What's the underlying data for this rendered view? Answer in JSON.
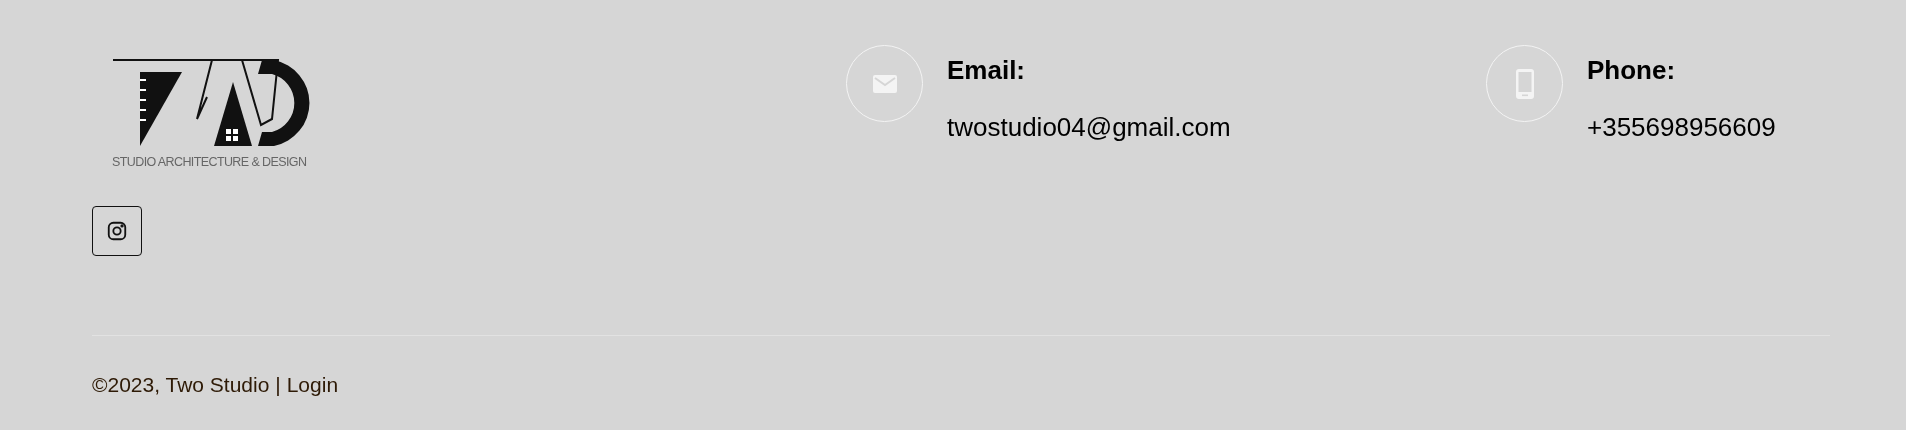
{
  "logo": {
    "tagline": "STUDIO ARCHITECTURE & DESIGN"
  },
  "social": [
    {
      "kind": "instagram"
    }
  ],
  "contacts": [
    {
      "kind": "email",
      "label": "Email:",
      "value": "twostudio04@gmail.com"
    },
    {
      "kind": "phone",
      "label": "Phone:",
      "value": "+355698956609"
    }
  ],
  "footer": {
    "copyright": "©2023, Two Studio |",
    "link": "Login"
  }
}
